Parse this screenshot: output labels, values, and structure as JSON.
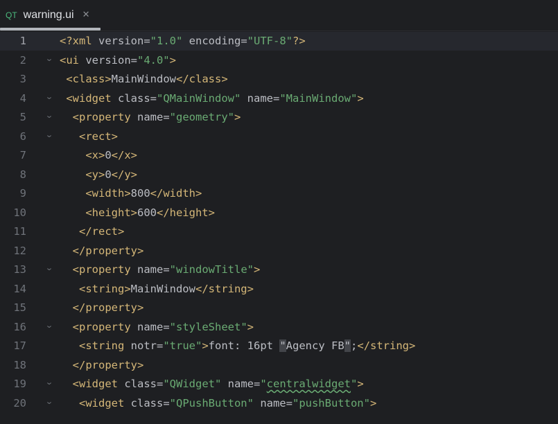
{
  "tab": {
    "icon_text": "QT",
    "title": "warning.ui",
    "close_glyph": "✕"
  },
  "colors": {
    "background": "#1e1f22",
    "tag": "#d5b778",
    "string": "#6aab73",
    "text": "#bcbec4",
    "line_number": "#6f737a"
  },
  "lines": [
    {
      "n": "1",
      "fold": false,
      "current": true,
      "indent": "",
      "html": [
        [
          "pi",
          "<?xml "
        ],
        [
          "a",
          "version="
        ],
        [
          "v",
          "\"1.0\""
        ],
        [
          "a",
          " encoding="
        ],
        [
          "v",
          "\"UTF-8\""
        ],
        [
          "pi",
          "?>"
        ]
      ]
    },
    {
      "n": "2",
      "fold": true,
      "indent": "",
      "html": [
        [
          "t",
          "<ui "
        ],
        [
          "a",
          "version="
        ],
        [
          "v",
          "\"4.0\""
        ],
        [
          "t",
          ">"
        ]
      ]
    },
    {
      "n": "3",
      "fold": false,
      "indent": " ",
      "html": [
        [
          "t",
          "<class>"
        ],
        [
          "x",
          "MainWindow"
        ],
        [
          "t",
          "</class>"
        ]
      ]
    },
    {
      "n": "4",
      "fold": true,
      "indent": " ",
      "html": [
        [
          "t",
          "<widget "
        ],
        [
          "a",
          "class="
        ],
        [
          "v",
          "\"QMainWindow\""
        ],
        [
          "a",
          " name="
        ],
        [
          "v",
          "\"MainWindow\""
        ],
        [
          "t",
          ">"
        ]
      ]
    },
    {
      "n": "5",
      "fold": true,
      "indent": "  ",
      "html": [
        [
          "t",
          "<property "
        ],
        [
          "a",
          "name="
        ],
        [
          "v",
          "\"geometry\""
        ],
        [
          "t",
          ">"
        ]
      ]
    },
    {
      "n": "6",
      "fold": true,
      "indent": "   ",
      "html": [
        [
          "t",
          "<rect>"
        ]
      ]
    },
    {
      "n": "7",
      "fold": false,
      "indent": "    ",
      "html": [
        [
          "t",
          "<x>"
        ],
        [
          "x",
          "0"
        ],
        [
          "t",
          "</x>"
        ]
      ]
    },
    {
      "n": "8",
      "fold": false,
      "indent": "    ",
      "html": [
        [
          "t",
          "<y>"
        ],
        [
          "x",
          "0"
        ],
        [
          "t",
          "</y>"
        ]
      ]
    },
    {
      "n": "9",
      "fold": false,
      "indent": "    ",
      "html": [
        [
          "t",
          "<width>"
        ],
        [
          "x",
          "800"
        ],
        [
          "t",
          "</width>"
        ]
      ]
    },
    {
      "n": "10",
      "fold": false,
      "indent": "    ",
      "html": [
        [
          "t",
          "<height>"
        ],
        [
          "x",
          "600"
        ],
        [
          "t",
          "</height>"
        ]
      ]
    },
    {
      "n": "11",
      "fold": false,
      "indent": "   ",
      "html": [
        [
          "t",
          "</rect>"
        ]
      ]
    },
    {
      "n": "12",
      "fold": false,
      "indent": "  ",
      "html": [
        [
          "t",
          "</property>"
        ]
      ]
    },
    {
      "n": "13",
      "fold": true,
      "indent": "  ",
      "html": [
        [
          "t",
          "<property "
        ],
        [
          "a",
          "name="
        ],
        [
          "v",
          "\"windowTitle\""
        ],
        [
          "t",
          ">"
        ]
      ]
    },
    {
      "n": "14",
      "fold": false,
      "indent": "   ",
      "html": [
        [
          "t",
          "<string>"
        ],
        [
          "x",
          "MainWindow"
        ],
        [
          "t",
          "</string>"
        ]
      ]
    },
    {
      "n": "15",
      "fold": false,
      "indent": "  ",
      "html": [
        [
          "t",
          "</property>"
        ]
      ]
    },
    {
      "n": "16",
      "fold": true,
      "indent": "  ",
      "html": [
        [
          "t",
          "<property "
        ],
        [
          "a",
          "name="
        ],
        [
          "v",
          "\"styleSheet\""
        ],
        [
          "t",
          ">"
        ]
      ]
    },
    {
      "n": "17",
      "fold": false,
      "indent": "   ",
      "html": [
        [
          "t",
          "<string "
        ],
        [
          "a",
          "notr="
        ],
        [
          "v",
          "\"true\""
        ],
        [
          "t",
          ">"
        ],
        [
          "x",
          "font: 16pt "
        ],
        [
          "hq",
          "\""
        ],
        [
          "x",
          "Agency FB"
        ],
        [
          "hq",
          "\""
        ],
        [
          "x",
          ";"
        ],
        [
          "t",
          "</string>"
        ]
      ]
    },
    {
      "n": "18",
      "fold": false,
      "indent": "  ",
      "html": [
        [
          "t",
          "</property>"
        ]
      ]
    },
    {
      "n": "19",
      "fold": true,
      "indent": "  ",
      "html": [
        [
          "t",
          "<widget "
        ],
        [
          "a",
          "class="
        ],
        [
          "v",
          "\"QWidget\""
        ],
        [
          "a",
          " name="
        ],
        [
          "v",
          "\""
        ],
        [
          "vu",
          "centralwidget"
        ],
        [
          "v",
          "\""
        ],
        [
          "t",
          ">"
        ]
      ]
    },
    {
      "n": "20",
      "fold": true,
      "indent": "   ",
      "html": [
        [
          "t",
          "<widget "
        ],
        [
          "a",
          "class="
        ],
        [
          "v",
          "\"QPushButton\""
        ],
        [
          "a",
          " name="
        ],
        [
          "v",
          "\"pushButton\""
        ],
        [
          "t",
          ">"
        ]
      ]
    }
  ]
}
